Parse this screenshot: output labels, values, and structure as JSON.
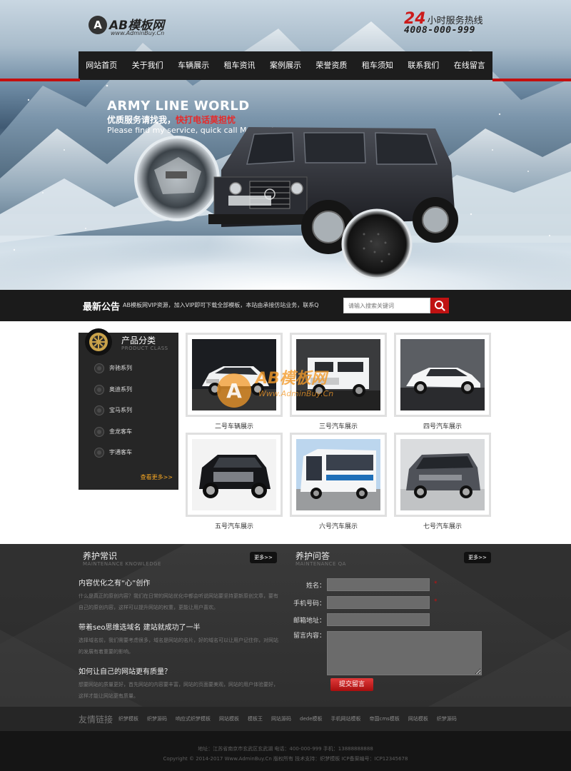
{
  "header": {
    "logo_badge": "A",
    "logo_text": "AB模板网",
    "logo_sub": "www.AdminBuy.Cn",
    "hotline_num": "24",
    "hotline_label": "小时服务热线",
    "hotline_phone": "4008-000-999"
  },
  "nav": {
    "items": [
      "网站首页",
      "关于我们",
      "车辆展示",
      "租车资讯",
      "案例展示",
      "荣誉资质",
      "租车须知",
      "联系我们",
      "在线留言"
    ]
  },
  "banner": {
    "title": "ARMY LINE WORLD",
    "cn_prefix": "优质服务请找我，",
    "cn_highlight": "快打电话莫担忧",
    "en": "Please find my service, quick call Mo worries."
  },
  "notice": {
    "title": "最新公告",
    "text": "AB模板网VIP资源，加入VIP即可下载全部模板，本站由承接仿站业务，联系Q",
    "search_placeholder": "请输入搜索关键词"
  },
  "sidebar": {
    "title": "产品分类",
    "subtitle": "PRODUCT CLASS",
    "items": [
      "奔驰系列",
      "奥迪系列",
      "宝马系列",
      "金龙客车",
      "宇通客车"
    ],
    "more": "查看更多>>"
  },
  "products": [
    {
      "caption": "二号车辆展示"
    },
    {
      "caption": "三号汽车展示"
    },
    {
      "caption": "四号汽车展示"
    },
    {
      "caption": "五号汽车展示"
    },
    {
      "caption": "六号汽车展示"
    },
    {
      "caption": "七号汽车展示"
    }
  ],
  "watermark": {
    "text": "AB模板网",
    "sub": "Www.AdminBuy.Cn"
  },
  "knowledge": {
    "title": "养护常识",
    "subtitle": "MAINTENANCE KNOWLEDGE",
    "more": "更多>>",
    "articles": [
      {
        "title": "内容优化之有“心”创作",
        "body": "什么是真正的原创内容？我们在日常的网站优化中都会听说网站要坚持更新原创文章，要有自己的原创内容，这样可以提升网站的权重，更能让用户喜欢。"
      },
      {
        "title": "带着seo思维选域名 建站就成功了一半",
        "body": "选择域名前，我们需要考虑很多，域名是网站的名片，好的域名可以让用户记住你，对网站的发展有着重要的影响。"
      },
      {
        "title": "如何让自己的网站更有质量？",
        "body": "想要网站的质量更好，首先网站的内容要丰富，网站的页面要美观，网站的用户体验要好，这样才能让网站更有质量。"
      }
    ]
  },
  "qa": {
    "title": "养护问答",
    "subtitle": "MAINTENANCE QA",
    "more": "更多>>",
    "labels": {
      "name": "姓名：",
      "phone": "手机号码：",
      "email": "邮箱地址：",
      "message": "留言内容："
    },
    "submit": "提交留言"
  },
  "friend_links": {
    "title": "友情链接",
    "items": [
      "织梦模板",
      "织梦源码",
      "响应式织梦模板",
      "网站模板",
      "模板王",
      "网站源码",
      "dede模板",
      "手机网站模板",
      "帝国cms模板",
      "网站模板",
      "织梦源码"
    ]
  },
  "footer": {
    "line1": "地址：江苏省南京市玄武区玄武湖   电话：400-000-999   手机：13888888888",
    "line2": "Copyright © 2014-2017 Www.AdminBuy.Cn 版权所有   技术支持：织梦模板   ICP备案编号：ICP12345678"
  },
  "colors": {
    "accent_red": "#c40f0f",
    "nav_bg": "#1d1d1d",
    "info_bg": "#333333",
    "more_orange": "#f5a623"
  }
}
